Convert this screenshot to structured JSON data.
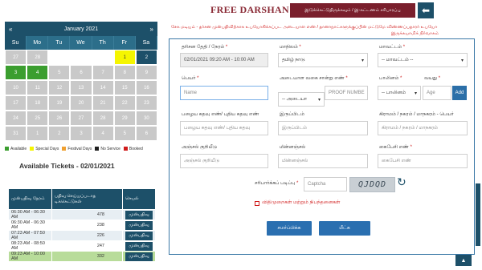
{
  "calendar": {
    "month_label": "January 2021",
    "prev": "«",
    "next": "»",
    "weekdays": [
      "Su",
      "Mo",
      "Tu",
      "We",
      "Th",
      "Fr",
      "Sa"
    ],
    "weeks": [
      [
        {
          "d": "27",
          "s": "grey"
        },
        {
          "d": "28",
          "s": "grey"
        },
        {
          "d": "",
          "s": "empty"
        },
        {
          "d": "",
          "s": "empty"
        },
        {
          "d": "",
          "s": "empty"
        },
        {
          "d": "1",
          "s": "special"
        },
        {
          "d": "2",
          "s": "today"
        }
      ],
      [
        {
          "d": "3",
          "s": "avail"
        },
        {
          "d": "4",
          "s": "avail"
        },
        {
          "d": "5",
          "s": "grey"
        },
        {
          "d": "6",
          "s": "grey"
        },
        {
          "d": "7",
          "s": "grey"
        },
        {
          "d": "8",
          "s": "grey"
        },
        {
          "d": "9",
          "s": "grey"
        }
      ],
      [
        {
          "d": "10",
          "s": "grey"
        },
        {
          "d": "11",
          "s": "grey"
        },
        {
          "d": "12",
          "s": "grey"
        },
        {
          "d": "13",
          "s": "grey"
        },
        {
          "d": "14",
          "s": "grey"
        },
        {
          "d": "15",
          "s": "grey"
        },
        {
          "d": "16",
          "s": "grey"
        }
      ],
      [
        {
          "d": "17",
          "s": "grey"
        },
        {
          "d": "18",
          "s": "grey"
        },
        {
          "d": "19",
          "s": "grey"
        },
        {
          "d": "20",
          "s": "grey"
        },
        {
          "d": "21",
          "s": "grey"
        },
        {
          "d": "22",
          "s": "grey"
        },
        {
          "d": "23",
          "s": "grey"
        }
      ],
      [
        {
          "d": "24",
          "s": "grey"
        },
        {
          "d": "25",
          "s": "grey"
        },
        {
          "d": "26",
          "s": "grey"
        },
        {
          "d": "27",
          "s": "grey"
        },
        {
          "d": "28",
          "s": "grey"
        },
        {
          "d": "29",
          "s": "grey"
        },
        {
          "d": "30",
          "s": "grey"
        }
      ],
      [
        {
          "d": "31",
          "s": "grey"
        },
        {
          "d": "1",
          "s": "grey"
        },
        {
          "d": "2",
          "s": "grey"
        },
        {
          "d": "3",
          "s": "grey"
        },
        {
          "d": "4",
          "s": "grey"
        },
        {
          "d": "5",
          "s": "grey"
        },
        {
          "d": "6",
          "s": "grey"
        }
      ]
    ],
    "legend": [
      {
        "label": "Available",
        "color": "#3b9e2f"
      },
      {
        "label": "Special Days",
        "color": "#f5f500"
      },
      {
        "label": "Festival Days",
        "color": "#f0a030"
      },
      {
        "label": "No Service",
        "color": "#1f1f1f"
      },
      {
        "label": "Booked",
        "color": "#d01b1b"
      }
    ]
  },
  "tickets": {
    "title": "Available Tickets - 02/01/2021",
    "headers": [
      "முன்பதிவு நேரம்",
      "பதிவு செய்யப்படாத டிக்கெட்டுகள்",
      "செயல்"
    ],
    "book_label": "முன்பதிவு",
    "rows": [
      {
        "time": "06:30 AM - 06:30 AM",
        "count": "478",
        "hl": false
      },
      {
        "time": "06:30 AM - 06:30 AM",
        "count": "238",
        "hl": false
      },
      {
        "time": "07:23 AM - 07:50 AM",
        "count": "226",
        "hl": false
      },
      {
        "time": "08:23 AM - 08:50 AM",
        "count": "247",
        "hl": false
      },
      {
        "time": "09:23 AM - 10:00 AM",
        "count": "332",
        "hl": true
      }
    ]
  },
  "header": {
    "title": "FREE DARSHAN",
    "top_button": "இடுக்கெட்டுதிருக்கவும் / இ-கட்டணம் சரிபாரப்பு",
    "back_icon": "arrow-left-icon",
    "notice_line1": "சேக மடியம் -      தர்சன முன்பதிவிற்காக உபயோகிக்கப்பட அடையாள எண் / தானாநாட்களுக்குப்பின் மட்டுமே விண்ணப்பதாரர் உபயோ",
    "notice_line2": "இருக்கயாமிக் நிர்வாகம்"
  },
  "form": {
    "date_label": "தரிசன தேதி / நேரம்",
    "date_value": "02/01/2021 09:20 AM - 10:00 AM",
    "state_label": "மாநிலம்",
    "state_value": "தமிழ் நாடு",
    "district_label": "மாவட்டம்",
    "district_value": "-- மாவட்டம் --",
    "name_label": "பெயர்",
    "name_placeholder": "Name",
    "idtype_label": "அடையாள வகை சான்று எண்",
    "idtype_value": "-- அடையா",
    "idproof_placeholder": "PROOF NUMBE",
    "gender_label": "பாலினம்",
    "gender_value": "-- பாலினம்",
    "age_label": "வயது",
    "age_placeholder": "Age",
    "add_label": "Add",
    "oldpin_label": "பழைய கதவு எண்/ புதிய கதவு எண்",
    "oldpin_placeholder": "பழைய கதவு எண்/ புதிய கதவு",
    "address_label": "இருப்பிடம்",
    "address_placeholder": "இருப்பிடம்",
    "village_label": "கிராமம் / நகரம் / மாநகரம் - பெயர்",
    "village_placeholder": "கிராமம் / நகரம் / மாநகரம்",
    "pincode_label": "அஞ்சல் குறியீடு",
    "pincode_placeholder": "அஞ்சல் குறியீடு",
    "email_label": "மின்னஞ்சல்",
    "email_placeholder": "மின்னஞ்சல்",
    "mobile_label": "கைபேசி எண்",
    "mobile_placeholder": "கைபேசி எண்",
    "captcha_label": "சரிபார்க்கப் படிப்பு",
    "captcha_placeholder": "Captcha",
    "captcha_code": "QJDQD",
    "terms_label": "விதிமுறைகள் மற்றும் நிபந்தனைகள்",
    "submit_label": "சமர்ப்பிக்க",
    "reset_label": "மீட்க"
  }
}
